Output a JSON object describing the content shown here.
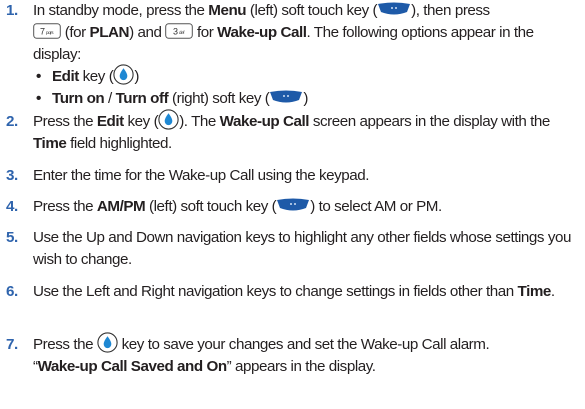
{
  "colors": {
    "step_number": "#2f64ad",
    "text": "#231f20",
    "softkey": "#1e5aa8",
    "navkey": "#1e88d3"
  },
  "icons": {
    "menu_softkey": "left-softkey-icon",
    "key_7": "key-7-pqrs-icon",
    "key_3": "key-3-def-icon",
    "edit_key": "edit-navkey-icon",
    "turn_on_softkey": "right-softkey-icon",
    "am_pm_softkey": "left-softkey-icon",
    "save_key": "edit-navkey-icon"
  },
  "key_labels": {
    "key7": "7",
    "key7_sub": "pqrs",
    "key3": "3",
    "key3_sub": "def"
  },
  "steps": [
    {
      "num": "1.",
      "a": "In standby mode, press the ",
      "b_menu": "Menu",
      "c": " (left) soft touch key (",
      "d": "), then press",
      "e": " (for ",
      "b_plan": "PLAN",
      "f": ") and ",
      "g": " for ",
      "b_wake": "Wake-up Call",
      "h": ". The following options appear in the display:"
    },
    {
      "num": "2.",
      "a": "Press the ",
      "b_edit": "Edit",
      "c": " key (",
      "d": "). The ",
      "b_wake": "Wake-up Call",
      "e": " screen appears in the display with the ",
      "b_time": "Time",
      "f": " field highlighted."
    },
    {
      "num": "3.",
      "text": "Enter the time for the Wake-up Call using the keypad."
    },
    {
      "num": "4.",
      "a": "Press the ",
      "b_ampm": "AM/PM",
      "c": " (left) soft touch key (",
      "d": ") to select AM or PM."
    },
    {
      "num": "5.",
      "text": "Use the Up and Down navigation keys to highlight any other fields whose settings you wish to change."
    },
    {
      "num": "6.",
      "a": "Use the Left and Right navigation keys to change settings in fields other than ",
      "b_time": "Time",
      "c": "."
    },
    {
      "num": "7.",
      "a": "Press the ",
      "b": " key to save your changes and set the Wake-up Call alarm.",
      "q_open": "“",
      "b_saved": "Wake-up Call Saved and On",
      "q_close": "”",
      "c": " appears in the display."
    }
  ],
  "options": [
    {
      "bullet": "•",
      "b_edit": "Edit",
      "a": " key (",
      "b": ")"
    },
    {
      "bullet": "•",
      "b_turnon": "Turn on",
      "sep": " / ",
      "b_turnoff": "Turn off",
      "a": " (right) soft key (",
      "b": ")"
    }
  ]
}
